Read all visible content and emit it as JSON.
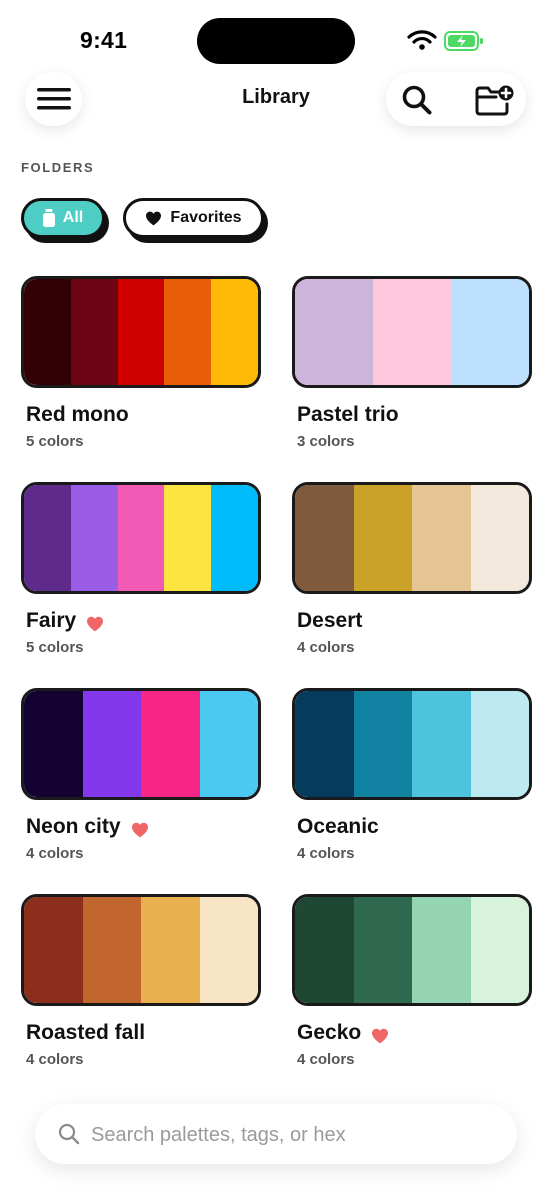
{
  "status_bar": {
    "time": "9:41",
    "battery_color": "#4cd964"
  },
  "header": {
    "title": "Library",
    "menu_icon": "hamburger-icon",
    "search_icon": "search-icon",
    "add_folder_icon": "folder-plus-icon"
  },
  "folders": {
    "label": "FOLDERS",
    "filters": [
      {
        "label": "All",
        "icon": "jar-icon",
        "selected": true,
        "color": "#4ecdc4"
      },
      {
        "label": "Favorites",
        "icon": "heart-icon",
        "selected": false
      }
    ]
  },
  "palettes": [
    {
      "name": "Red mono",
      "count": "5 colors",
      "favorite": false,
      "colors": [
        "#330005",
        "#6d0614",
        "#d00000",
        "#e85d0a",
        "#ffba08"
      ]
    },
    {
      "name": "Pastel trio",
      "count": "3 colors",
      "favorite": false,
      "colors": [
        "#cdb4db",
        "#ffc8dd",
        "#bde0fe"
      ]
    },
    {
      "name": "Fairy",
      "count": "5 colors",
      "favorite": true,
      "colors": [
        "#5e2a8c",
        "#9b5de5",
        "#f15bb5",
        "#fee440",
        "#00bbf9"
      ]
    },
    {
      "name": "Desert",
      "count": "4 colors",
      "favorite": false,
      "colors": [
        "#7f5a3c",
        "#c9a227",
        "#e6c594",
        "#f3e9dc"
      ]
    },
    {
      "name": "Neon city",
      "count": "4 colors",
      "favorite": true,
      "colors": [
        "#120131",
        "#8338ec",
        "#f72585",
        "#4cc9f0"
      ]
    },
    {
      "name": "Oceanic",
      "count": "4 colors",
      "favorite": false,
      "colors": [
        "#053c5e",
        "#1282a2",
        "#4ec3dc",
        "#bde9f3"
      ]
    },
    {
      "name": "Roasted fall",
      "count": "4 colors",
      "favorite": false,
      "colors": [
        "#8b2f1c",
        "#c26630",
        "#e8b04e",
        "#f7e5c6"
      ]
    },
    {
      "name": "Gecko",
      "count": "4 colors",
      "favorite": true,
      "colors": [
        "#1e4734",
        "#2f6a50",
        "#95d5b2",
        "#d8f3dc"
      ]
    }
  ],
  "heart_color": "#f06565",
  "bottom_search": {
    "placeholder": "Search palettes, tags, or hex"
  }
}
